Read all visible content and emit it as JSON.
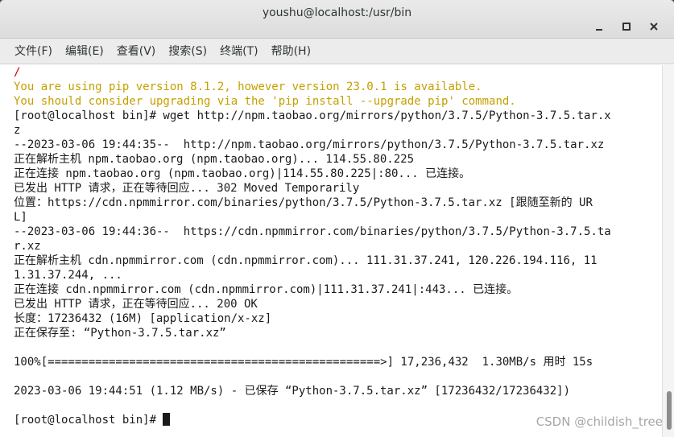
{
  "window": {
    "title": "youshu@localhost:/usr/bin"
  },
  "menu": [
    "文件(F)",
    "编辑(E)",
    "查看(V)",
    "搜索(S)",
    "终端(T)",
    "帮助(H)"
  ],
  "terminal": {
    "lines": [
      "/",
      "You are using pip version 8.1.2, however version 23.0.1 is available.",
      "You should consider upgrading via the 'pip install --upgrade pip' command.",
      "[root@localhost bin]# wget http://npm.taobao.org/mirrors/python/3.7.5/Python-3.7.5.tar.x",
      "z",
      "--2023-03-06 19:44:35--  http://npm.taobao.org/mirrors/python/3.7.5/Python-3.7.5.tar.xz",
      "正在解析主机 npm.taobao.org (npm.taobao.org)... 114.55.80.225",
      "正在连接 npm.taobao.org (npm.taobao.org)|114.55.80.225|:80... 已连接。",
      "已发出 HTTP 请求，正在等待回应... 302 Moved Temporarily",
      "位置：https://cdn.npmmirror.com/binaries/python/3.7.5/Python-3.7.5.tar.xz [跟随至新的 UR",
      "L]",
      "--2023-03-06 19:44:36--  https://cdn.npmmirror.com/binaries/python/3.7.5/Python-3.7.5.ta",
      "r.xz",
      "正在解析主机 cdn.npmmirror.com (cdn.npmmirror.com)... 111.31.37.241, 120.226.194.116, 11",
      "1.31.37.244, ...",
      "正在连接 cdn.npmmirror.com (cdn.npmmirror.com)|111.31.37.241|:443... 已连接。",
      "已发出 HTTP 请求，正在等待回应... 200 OK",
      "长度：17236432 (16M) [application/x-xz]",
      "正在保存至: “Python-3.7.5.tar.xz”",
      "",
      "100%[=================================================>] 17,236,432  1.30MB/s 用时 15s",
      "",
      "2023-03-06 19:44:51 (1.12 MB/s) - 已保存 “Python-3.7.5.tar.xz” [17236432/17236432])",
      "",
      "[root@localhost bin]# "
    ],
    "line_styles": [
      "slash",
      "warn",
      "warn",
      "",
      "",
      "",
      "",
      "",
      "",
      "",
      "",
      "",
      "",
      "",
      "",
      "",
      "",
      "",
      "",
      "",
      "",
      "",
      "",
      "",
      ""
    ]
  },
  "watermark": "CSDN @childish_tree"
}
